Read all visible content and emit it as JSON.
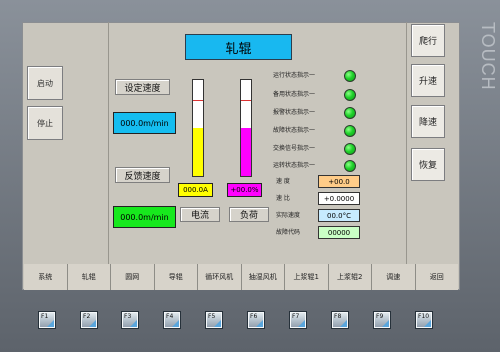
{
  "brand": "TOUCH",
  "left_buttons": [
    {
      "label": "启动"
    },
    {
      "label": "停止"
    }
  ],
  "right_buttons": [
    {
      "label": "爬行"
    },
    {
      "label": "升速"
    },
    {
      "label": "降速"
    },
    {
      "label": "恢复"
    }
  ],
  "title": "轧辊",
  "speed": {
    "set_label": "设定速度",
    "set_value": "000.0m/min",
    "feedback_label": "反馈速度",
    "feedback_value": "000.0m/min"
  },
  "gauges": [
    {
      "label": "电流",
      "value": "000.0A",
      "color": "#ffff00",
      "fill": 0.5
    },
    {
      "label": "负荷",
      "value": "+00.0%",
      "color": "#ff00ff",
      "fill": 0.5
    }
  ],
  "status": {
    "labels": [
      "运行状态指示一",
      "备用状态指示一",
      "报警状态指示一",
      "故障状态指示一",
      "交换信号指示一",
      "运转状态指示一"
    ]
  },
  "params": [
    {
      "label": "速 度",
      "value": "+00.0",
      "bg": "#ffcc88"
    },
    {
      "label": "速 比",
      "value": "+0.0000",
      "bg": "#ffffff"
    },
    {
      "label": "实际速度",
      "value": "00.0°C",
      "bg": "#c7ebff"
    },
    {
      "label": "故障代码",
      "value": "00000",
      "bg": "#caffc6"
    }
  ],
  "tabs": [
    {
      "label": "系统"
    },
    {
      "label": "轧辊"
    },
    {
      "label": "圆网"
    },
    {
      "label": "导辊"
    },
    {
      "label": "循环风机"
    },
    {
      "label": "抽湿风机"
    },
    {
      "label": "上浆辊1"
    },
    {
      "label": "上浆辊2"
    },
    {
      "label": "调速"
    },
    {
      "label": "返回"
    }
  ],
  "function_keys": [
    {
      "label": "F1"
    },
    {
      "label": "F2"
    },
    {
      "label": "F3"
    },
    {
      "label": "F4"
    },
    {
      "label": "F5"
    },
    {
      "label": "F6"
    },
    {
      "label": "F7"
    },
    {
      "label": "F8"
    },
    {
      "label": "F9"
    },
    {
      "label": "F10"
    }
  ]
}
